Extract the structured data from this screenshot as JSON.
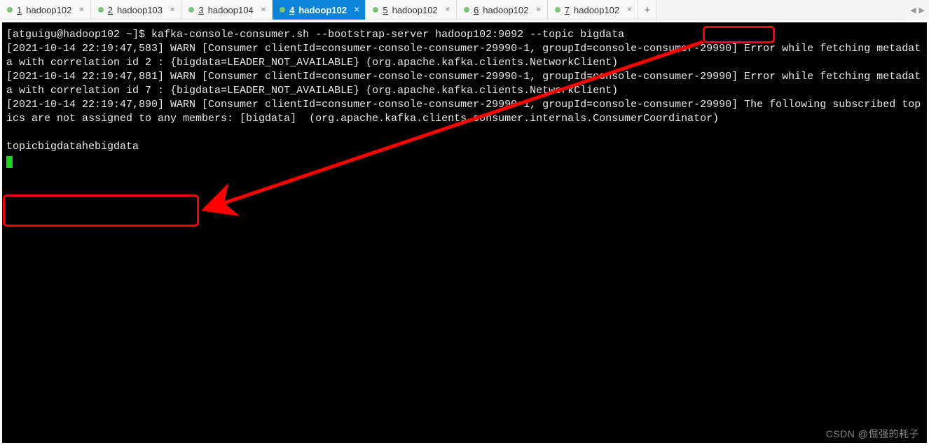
{
  "tabs": [
    {
      "num": "1",
      "label": "hadoop102",
      "active": false
    },
    {
      "num": "2",
      "label": "hadoop103",
      "active": false
    },
    {
      "num": "3",
      "label": "hadoop104",
      "active": false
    },
    {
      "num": "4",
      "label": "hadoop102",
      "active": true
    },
    {
      "num": "5",
      "label": "hadoop102",
      "active": false
    },
    {
      "num": "6",
      "label": "hadoop102",
      "active": false
    },
    {
      "num": "7",
      "label": "hadoop102",
      "active": false
    }
  ],
  "add_button": "+",
  "nav": {
    "left": "◀",
    "right": "▶"
  },
  "terminal": {
    "prompt": "[atguigu@hadoop102 ~]$ ",
    "command": "kafka-console-consumer.sh --bootstrap-server hadoop102:9092 --topic ",
    "topic_arg": "bigdata",
    "log1": "[2021-10-14 22:19:47,583] WARN [Consumer clientId=consumer-console-consumer-29990-1, groupId=console-consumer-29990] Error while fetching metadata with correlation id 2 : {bigdata=LEADER_NOT_AVAILABLE} (org.apache.kafka.clients.NetworkClient)",
    "log2": "[2021-10-14 22:19:47,881] WARN [Consumer clientId=consumer-console-consumer-29990-1, groupId=console-consumer-29990] Error while fetching metadata with correlation id 7 : {bigdata=LEADER_NOT_AVAILABLE} (org.apache.kafka.clients.NetworkClient)",
    "log3": "[2021-10-14 22:19:47,890] WARN [Consumer clientId=consumer-console-consumer-29990-1, groupId=console-consumer-29990] The following subscribed topics are not assigned to any members: [bigdata]  (org.apache.kafka.clients.consumer.internals.ConsumerCoordinator)",
    "blank": "",
    "message": "topicbigdatahebigdata"
  },
  "watermark": "CSDN @倔强的耗子"
}
